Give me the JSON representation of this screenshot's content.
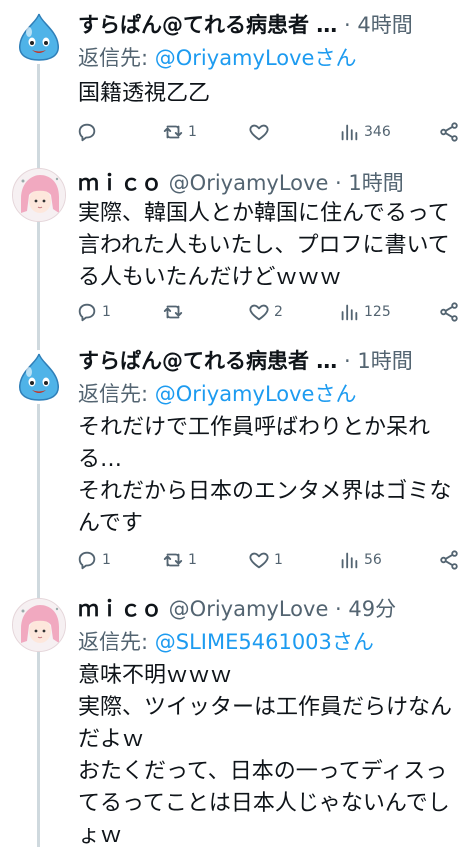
{
  "tweets": [
    {
      "name": "すらぱん@てれる病患者 …",
      "meta": " · 4時間",
      "reply_label": "返信先: ",
      "reply_handle": "@OriyamyLoveさん",
      "text": "国籍透視乙乙",
      "replies": "",
      "retweets": "1",
      "likes": "",
      "views": "346"
    },
    {
      "name": "ｍｉｃｏ",
      "meta": " @OriyamyLove · 1時間",
      "text": "実際、韓国人とか韓国に住んでるって言われた人もいたし、プロフに書いてる人もいたんだけどｗｗｗ",
      "replies": "1",
      "retweets": "",
      "likes": "2",
      "views": "125"
    },
    {
      "name": "すらぱん@てれる病患者 …",
      "meta": " · 1時間",
      "reply_label": "返信先: ",
      "reply_handle": "@OriyamyLoveさん",
      "text": "それだけで工作員呼ばわりとか呆れる…\nそれだから日本のエンタメ界はゴミなんです",
      "replies": "1",
      "retweets": "1",
      "likes": "1",
      "views": "56"
    },
    {
      "name": "ｍｉｃｏ",
      "meta": " @OriyamyLove · 49分",
      "reply_label": "返信先: ",
      "reply_handle": "@SLIME5461003さん",
      "text": "意味不明ｗｗｗ\n実際、ツイッターは工作員だらけなんだよｗ\nおたくだって、日本の一ってディスってるってことは日本人じゃないんでしょｗ"
    }
  ],
  "icons": {
    "reply": "reply-icon",
    "retweet": "retweet-icon",
    "like": "heart-icon",
    "views": "views-icon",
    "share": "share-icon"
  },
  "colors": {
    "link": "#1d9bf0",
    "muted": "#536471",
    "text": "#0f1419",
    "slime": "#4fb3e8",
    "thread_line": "#cfd9de"
  }
}
